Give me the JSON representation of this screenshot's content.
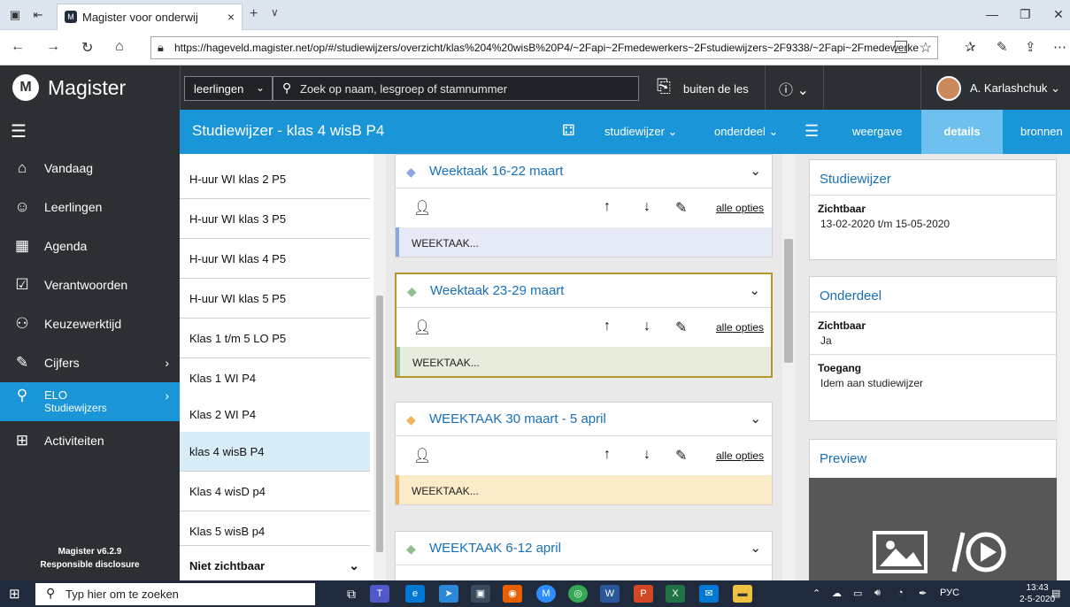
{
  "browser": {
    "tab_title": "Magister voor onderwij",
    "tab_close": "×",
    "new_tab": "+",
    "tab_menu": "∨",
    "url": "https://hageveld.magister.net/op/#/studiewijzers/overzicht/klas%204%20wisB%20P4/~2Fapi~2Fmedewerkers~2Fstudiewijzers~2F9338/~2Fapi~2Fmedewerke",
    "win_min": "—",
    "win_max": "❐",
    "win_close": "✕"
  },
  "header": {
    "logo_text": "Magister",
    "select_value": "leerlingen",
    "search_placeholder": "Zoek op naam, lesgroep of stamnummer",
    "buiten_label": "buiten de les",
    "user_name": "A. Karlashchuk"
  },
  "sidebar": {
    "items": [
      {
        "label": "Vandaag",
        "icon": "home-icon"
      },
      {
        "label": "Leerlingen",
        "icon": "students-icon"
      },
      {
        "label": "Agenda",
        "icon": "calendar-icon"
      },
      {
        "label": "Verantwoorden",
        "icon": "checkbox-icon"
      },
      {
        "label": "Keuzewerktijd",
        "icon": "users-clock-icon"
      },
      {
        "label": "Cijfers",
        "icon": "pencil-icon"
      },
      {
        "label": "ELO",
        "sublabel": "Studiewijzers",
        "icon": "elo-icon"
      },
      {
        "label": "Activiteiten",
        "icon": "activity-icon"
      }
    ],
    "version": "Magister v6.2.9",
    "disclosure": "Responsible disclosure"
  },
  "titlebar": {
    "title": "Studiewijzer - klas 4 wisB P4",
    "studiewijzer_menu": "studiewijzer",
    "onderdeel_menu": "onderdeel",
    "weergave": "weergave",
    "details": "details",
    "bronnen": "bronnen"
  },
  "list": {
    "items": [
      "H-uur WI klas 2 P5",
      "H-uur WI klas 3 P5",
      "H-uur WI klas 4 P5",
      "H-uur WI klas 5 P5",
      "Klas 1 t/m 5 LO P5",
      "Klas 1 WI P4",
      "Klas 2 WI P4",
      "klas 4 wisB P4",
      "Klas 4 wisD p4",
      "Klas 5 wisB p4"
    ],
    "footer": "Niet zichtbaar"
  },
  "cards": [
    {
      "title": "Weektaak 16-22 maart",
      "options": "alle opties",
      "body": "WEEKTAAK...",
      "tag_color": "#8aa8e0",
      "accent": "#8aa8e0",
      "body_bg": "#e6eaf6"
    },
    {
      "title": "Weektaak 23-29 maart",
      "options": "alle opties",
      "body": "WEEKTAAK...",
      "tag_color": "#8fbf8f",
      "accent": "#9bc49b",
      "body_bg": "#e6eddc"
    },
    {
      "title": "WEEKTAAK 30 maart - 5 april",
      "options": "alle opties",
      "body": "WEEKTAAK...",
      "tag_color": "#f2b55a",
      "accent": "#f2b55a",
      "body_bg": "#fbecc9"
    },
    {
      "title": "WEEKTAAK 6-12 april",
      "tag_color": "#8fbf8f"
    }
  ],
  "details": {
    "studiewijzer_title": "Studiewijzer",
    "sw_label": "Zichtbaar",
    "sw_value": "13-02-2020 t/m 15-05-2020",
    "onderdeel_title": "Onderdeel",
    "od_zichtbaar_label": "Zichtbaar",
    "od_zichtbaar_value": "Ja",
    "od_toegang_label": "Toegang",
    "od_toegang_value": "Idem aan studiewijzer",
    "preview_title": "Preview"
  },
  "taskbar": {
    "search_placeholder": "Typ hier om te zoeken",
    "lang": "РУС",
    "time": "13:43",
    "date": "2-5-2020"
  }
}
